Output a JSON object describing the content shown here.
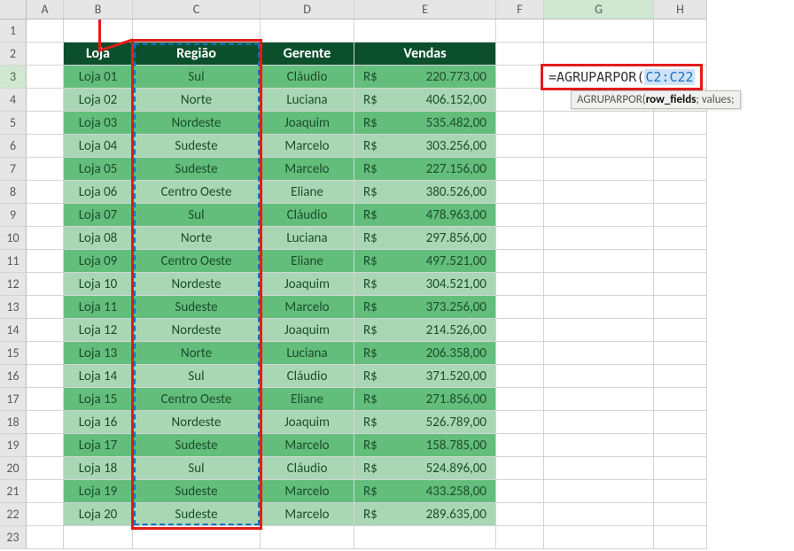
{
  "columns": [
    "A",
    "B",
    "C",
    "D",
    "E",
    "F",
    "G",
    "H"
  ],
  "rowCount": 23,
  "activeCell": "G3",
  "headers": {
    "loja": "Loja",
    "regiao": "Região",
    "gerente": "Gerente",
    "vendas": "Vendas"
  },
  "currency": "R$",
  "rows": [
    {
      "loja": "Loja 01",
      "regiao": "Sul",
      "gerente": "Cláudio",
      "vendas": "220.773,00"
    },
    {
      "loja": "Loja 02",
      "regiao": "Norte",
      "gerente": "Luciana",
      "vendas": "406.152,00"
    },
    {
      "loja": "Loja 03",
      "regiao": "Nordeste",
      "gerente": "Joaquim",
      "vendas": "535.482,00"
    },
    {
      "loja": "Loja 04",
      "regiao": "Sudeste",
      "gerente": "Marcelo",
      "vendas": "303.256,00"
    },
    {
      "loja": "Loja 05",
      "regiao": "Sudeste",
      "gerente": "Marcelo",
      "vendas": "227.156,00"
    },
    {
      "loja": "Loja 06",
      "regiao": "Centro Oeste",
      "gerente": "Eliane",
      "vendas": "380.526,00"
    },
    {
      "loja": "Loja 07",
      "regiao": "Sul",
      "gerente": "Cláudio",
      "vendas": "478.963,00"
    },
    {
      "loja": "Loja 08",
      "regiao": "Norte",
      "gerente": "Luciana",
      "vendas": "297.856,00"
    },
    {
      "loja": "Loja 09",
      "regiao": "Centro Oeste",
      "gerente": "Eliane",
      "vendas": "497.521,00"
    },
    {
      "loja": "Loja 10",
      "regiao": "Nordeste",
      "gerente": "Joaquim",
      "vendas": "304.521,00"
    },
    {
      "loja": "Loja 11",
      "regiao": "Sudeste",
      "gerente": "Marcelo",
      "vendas": "373.256,00"
    },
    {
      "loja": "Loja 12",
      "regiao": "Nordeste",
      "gerente": "Joaquim",
      "vendas": "214.526,00"
    },
    {
      "loja": "Loja 13",
      "regiao": "Norte",
      "gerente": "Luciana",
      "vendas": "206.358,00"
    },
    {
      "loja": "Loja 14",
      "regiao": "Sul",
      "gerente": "Cláudio",
      "vendas": "371.520,00"
    },
    {
      "loja": "Loja 15",
      "regiao": "Centro Oeste",
      "gerente": "Eliane",
      "vendas": "271.856,00"
    },
    {
      "loja": "Loja 16",
      "regiao": "Nordeste",
      "gerente": "Joaquim",
      "vendas": "526.789,00"
    },
    {
      "loja": "Loja 17",
      "regiao": "Sudeste",
      "gerente": "Marcelo",
      "vendas": "158.785,00"
    },
    {
      "loja": "Loja 18",
      "regiao": "Sul",
      "gerente": "Cláudio",
      "vendas": "524.896,00"
    },
    {
      "loja": "Loja 19",
      "regiao": "Sudeste",
      "gerente": "Marcelo",
      "vendas": "433.258,00"
    },
    {
      "loja": "Loja 20",
      "regiao": "Sudeste",
      "gerente": "Marcelo",
      "vendas": "289.635,00"
    }
  ],
  "formula": {
    "prefix": "=AGRUPARPOR(",
    "ref": "C2:C22"
  },
  "tooltip": {
    "func": "AGRUPARPOR(",
    "bold": "row_fields",
    "rest": "; values;"
  },
  "selection": {
    "range": "C2:C22"
  }
}
